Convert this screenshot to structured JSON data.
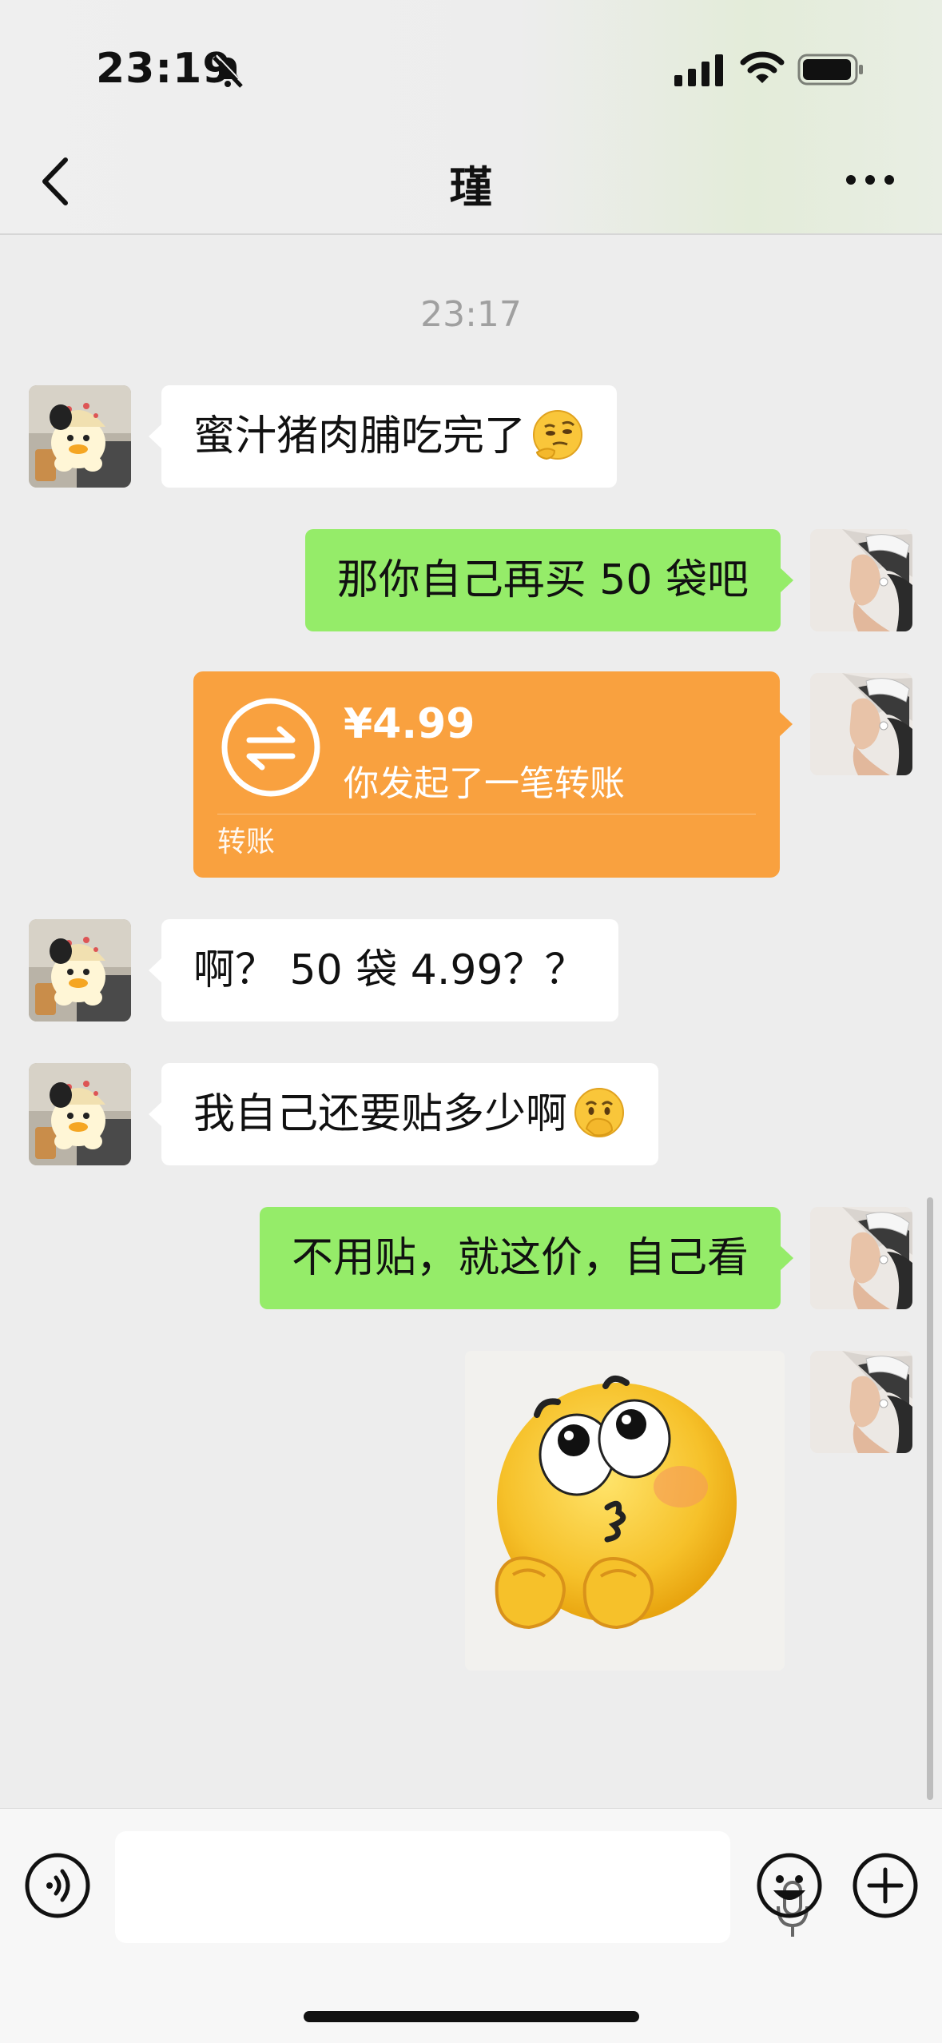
{
  "status_bar": {
    "time": "23:19"
  },
  "header": {
    "title": "瑾"
  },
  "timestamp": "23:17",
  "messages": [
    {
      "side": "in",
      "text": "蜜汁猪肉脯吃完了",
      "emoji": "thinking-face-emoji"
    },
    {
      "side": "out",
      "text": "那你自己再买 50 袋吧"
    },
    {
      "side": "out",
      "type": "transfer",
      "amount": "¥4.99",
      "description": "你发起了一笔转账",
      "label": "转账"
    },
    {
      "side": "in",
      "text": "啊？ 50 袋 4.99？？"
    },
    {
      "side": "in",
      "text": "我自己还要贴多少啊",
      "emoji": "face-with-hand-over-mouth-emoji"
    },
    {
      "side": "out",
      "text": "不用贴，就这价，自己看"
    },
    {
      "side": "out",
      "type": "sticker",
      "sticker": "looking-up-emoji-sticker"
    }
  ],
  "input_bar": {
    "voice_icon": "voice-icon",
    "mic_icon": "mic-icon",
    "emoji_icon": "smiley-icon",
    "plus_icon": "plus-icon"
  },
  "colors": {
    "outgoing_bubble": "#95ec69",
    "incoming_bubble": "#ffffff",
    "transfer_card": "#f9a13f",
    "background": "#ededed"
  }
}
